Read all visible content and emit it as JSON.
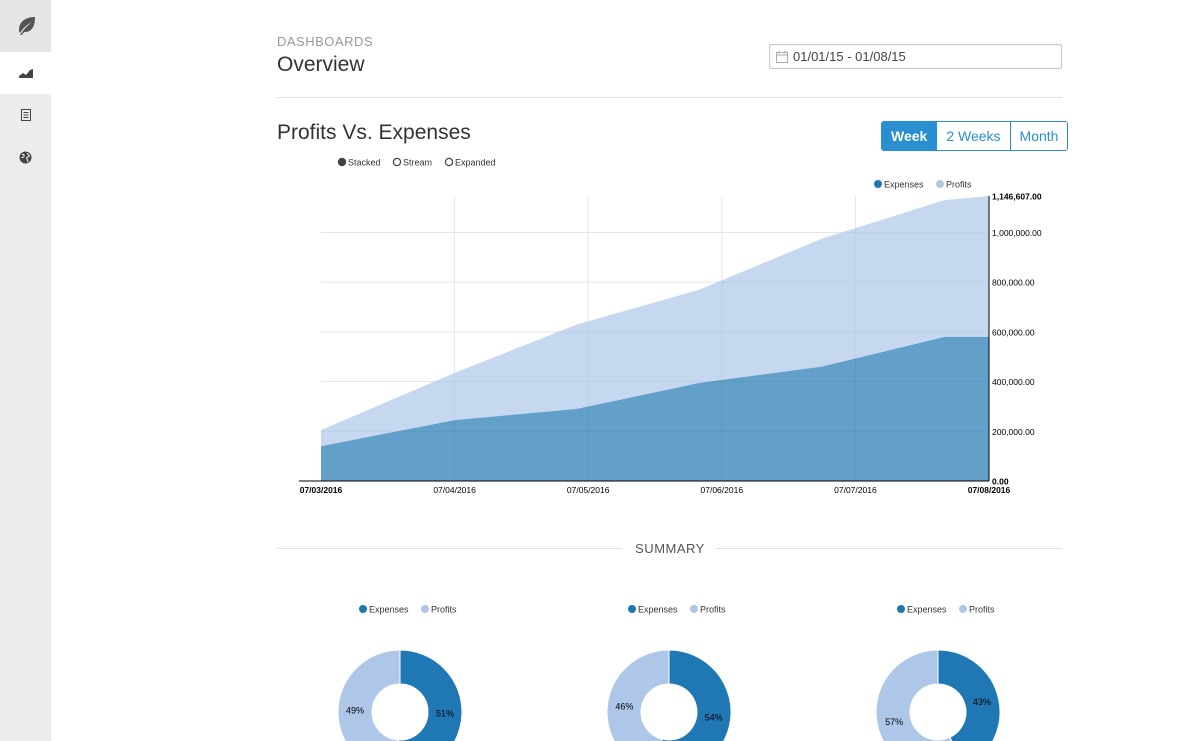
{
  "header": {
    "breadcrumb": "DASHBOARDS",
    "title": "Overview",
    "date_range_value": "01/01/15 - 01/08/15"
  },
  "sidebar": {
    "items": [
      {
        "icon": "leaf-icon"
      },
      {
        "icon": "area-chart-icon",
        "active": true
      },
      {
        "icon": "document-icon"
      },
      {
        "icon": "globe-icon"
      }
    ]
  },
  "section": {
    "title": "Profits Vs. Expenses",
    "range_buttons": [
      "Week",
      "2 Weeks",
      "Month"
    ],
    "active_range": "Week",
    "modes": [
      "Stacked",
      "Stream",
      "Expanded"
    ],
    "active_mode": "Stacked"
  },
  "colors": {
    "expenses": "#1f77b4",
    "profits": "#aec7e8",
    "accent": "#2a8fd0"
  },
  "summary": {
    "label": "SUMMARY"
  },
  "chart_data": [
    {
      "type": "area",
      "stacked": true,
      "legend_position": "top-right",
      "x": [
        "07/03/2016",
        "07/04/2016",
        "07/05/2016",
        "07/06/2016",
        "07/07/2016",
        "07/08/2016"
      ],
      "x_tick_labels": [
        "07/03/2016",
        "07/04/2016",
        "07/05/2016",
        "07/06/2016",
        "07/07/2016",
        "07/08/2016"
      ],
      "x_points": [
        "07/03/2016 00:00",
        "07/04/2016 00:00",
        "07/04/2016 22:00",
        "07/05/2016 20:00",
        "07/06/2016 18:00",
        "07/07/2016 16:00",
        "07/08/2016 00:00"
      ],
      "y_tick_labels": [
        "0.00",
        "200,000.00",
        "400,000.00",
        "600,000.00",
        "800,000.00",
        "1,000,000.00",
        "1,146,607.00"
      ],
      "y_axis_side": "right",
      "ylim": [
        0,
        1146607
      ],
      "grid": true,
      "series": [
        {
          "name": "Expenses",
          "values": [
            140000,
            245000,
            290000,
            395000,
            460000,
            580000,
            580000
          ]
        },
        {
          "name": "Profits",
          "values": [
            65000,
            190000,
            340000,
            375000,
            515000,
            550000,
            566607
          ]
        }
      ]
    },
    {
      "type": "pie",
      "donut": true,
      "legend": [
        "Expenses",
        "Profits"
      ],
      "values": [
        51,
        49
      ],
      "labels": [
        "51%",
        "49%"
      ]
    },
    {
      "type": "pie",
      "donut": true,
      "legend": [
        "Expenses",
        "Profits"
      ],
      "values": [
        54,
        46
      ],
      "labels": [
        "54%",
        "46%"
      ]
    },
    {
      "type": "pie",
      "donut": true,
      "legend": [
        "Expenses",
        "Profits"
      ],
      "values": [
        43,
        57
      ],
      "labels": [
        "43%",
        "57%"
      ]
    }
  ]
}
